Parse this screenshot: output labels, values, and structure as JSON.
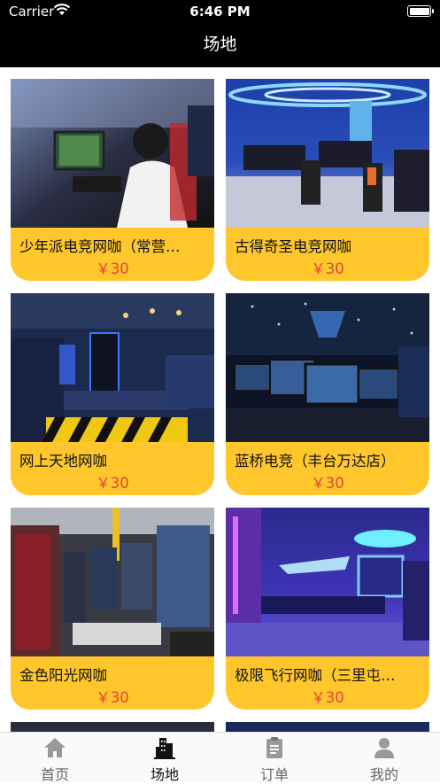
{
  "status_bar": {
    "carrier": "Carrier",
    "time": "6:46 PM"
  },
  "nav": {
    "title": "场地"
  },
  "venues": [
    {
      "name": "少年派电竞网咖（常营…",
      "price": "￥30"
    },
    {
      "name": "古得奇圣电竞网咖",
      "price": "￥30"
    },
    {
      "name": "网上天地网咖",
      "price": "￥30"
    },
    {
      "name": "蓝桥电竞（丰台万达店）",
      "price": "￥30"
    },
    {
      "name": "金色阳光网咖",
      "price": "￥30"
    },
    {
      "name": "极限飞行网咖（三里屯…",
      "price": "￥30"
    }
  ],
  "tabs": [
    {
      "label": "首页",
      "icon": "home-icon"
    },
    {
      "label": "场地",
      "icon": "building-icon",
      "active": true
    },
    {
      "label": "订单",
      "icon": "clipboard-icon"
    },
    {
      "label": "我的",
      "icon": "person-icon"
    }
  ],
  "colors": {
    "card_bg": "#ffc72c",
    "price": "#e8413a",
    "header_bg": "#000000"
  }
}
